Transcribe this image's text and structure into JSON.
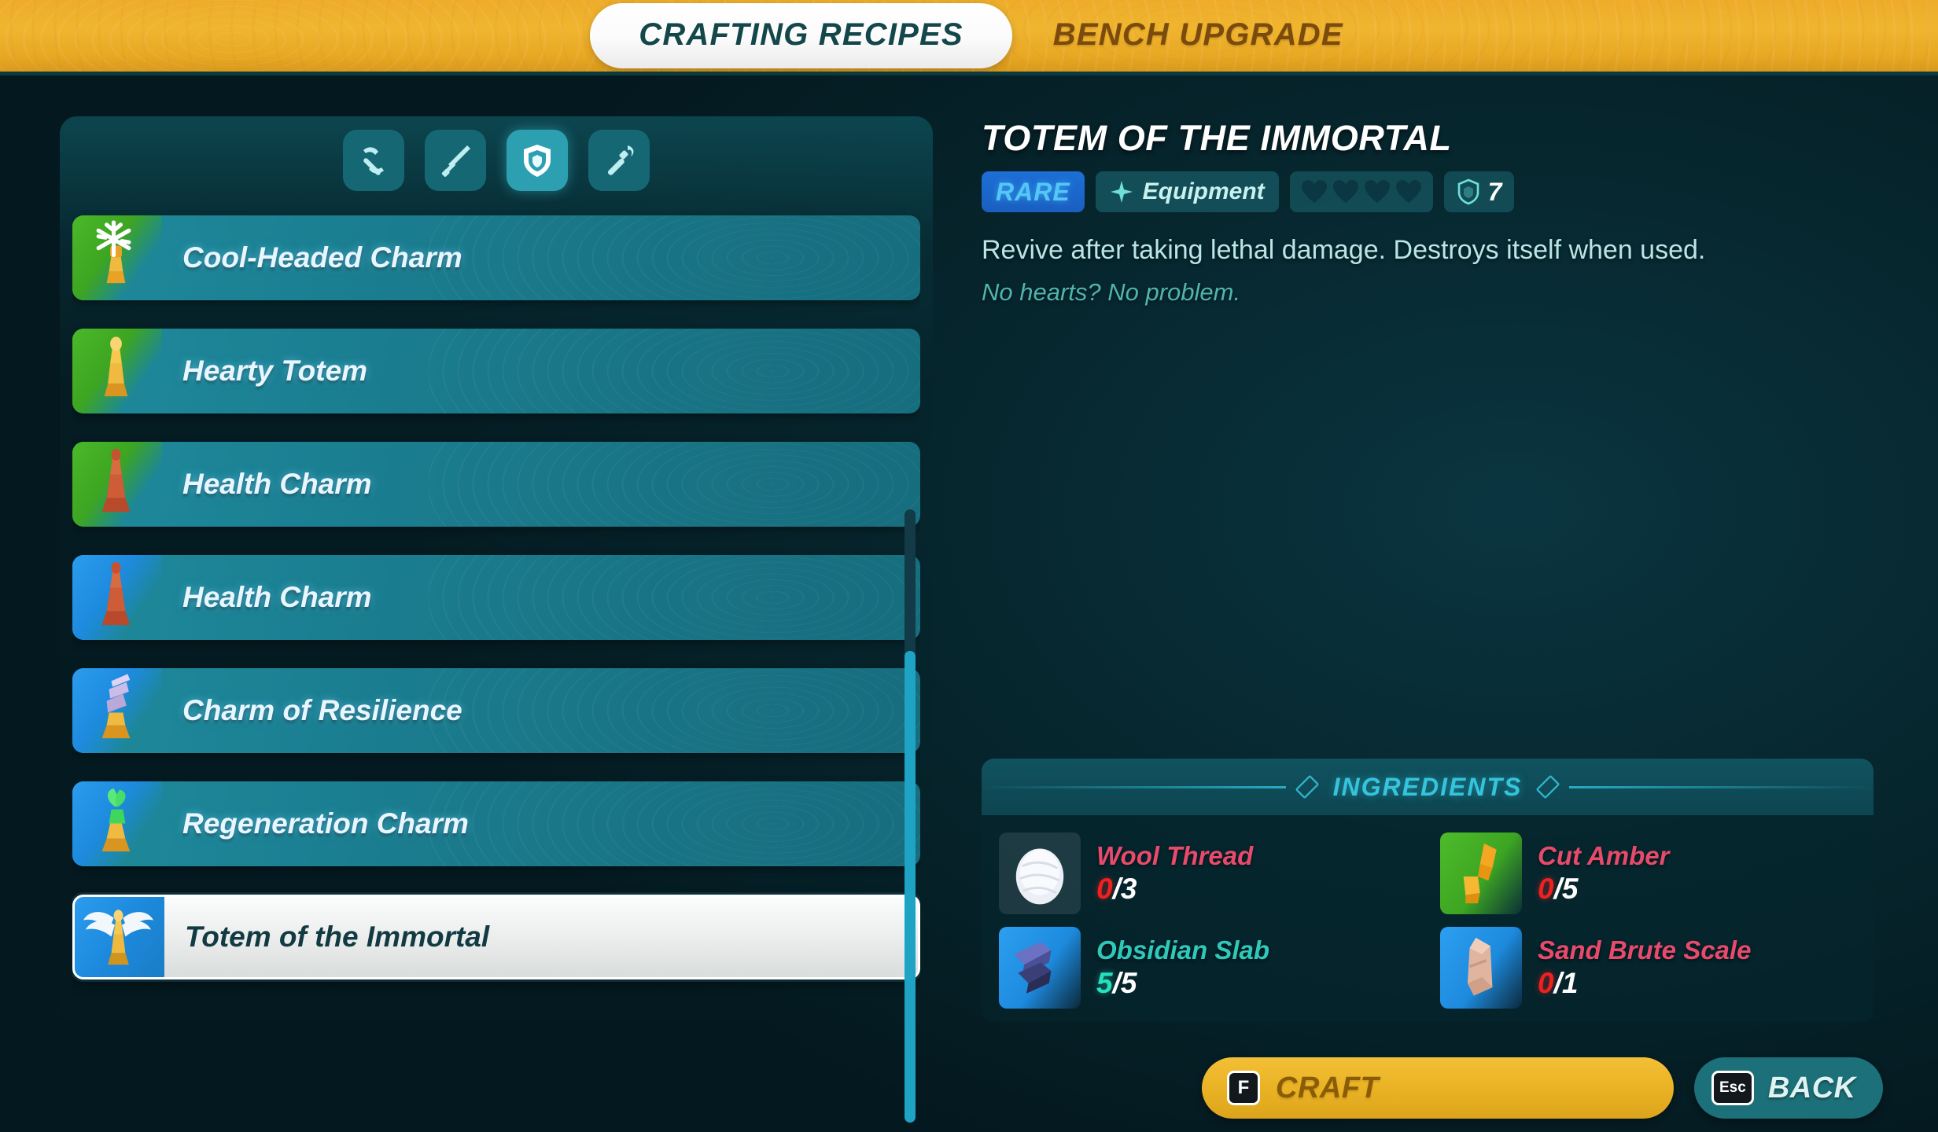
{
  "tabs": [
    {
      "label": "CRAFTING RECIPES",
      "active": true
    },
    {
      "label": "BENCH UPGRADE",
      "active": false
    }
  ],
  "filters": [
    {
      "name": "pickaxe",
      "selected": false
    },
    {
      "name": "sword",
      "selected": false
    },
    {
      "name": "shield",
      "selected": true
    },
    {
      "name": "torch",
      "selected": false
    }
  ],
  "recipes": [
    {
      "name": "",
      "rarity": "clipped",
      "icon": ""
    },
    {
      "name": "Cool-Headed Charm",
      "rarity": "green",
      "icon": "snowflake-totem"
    },
    {
      "name": "Hearty Totem",
      "rarity": "green",
      "icon": "gold-totem"
    },
    {
      "name": "Health Charm",
      "rarity": "green",
      "icon": "red-totem"
    },
    {
      "name": "Health Charm",
      "rarity": "blue",
      "icon": "red-totem"
    },
    {
      "name": "Charm of Resilience",
      "rarity": "blue",
      "icon": "purple-totem"
    },
    {
      "name": "Regeneration Charm",
      "rarity": "blue",
      "icon": "green-totem"
    },
    {
      "name": "Totem of the Immortal",
      "rarity": "blue",
      "icon": "winged-totem",
      "selected": true
    }
  ],
  "detail": {
    "title": "TOTEM OF THE IMMORTAL",
    "rarity": "RARE",
    "type": "Equipment",
    "hearts": 4,
    "defense": "7",
    "description": "Revive after taking lethal damage. Destroys itself when used.",
    "flavor": "No hearts? No problem."
  },
  "ingredients": {
    "header": "INGREDIENTS",
    "items": [
      {
        "name": "Wool Thread",
        "current": "0",
        "max": "/3",
        "status": "lack",
        "icon": "wool-ball"
      },
      {
        "name": "Cut Amber",
        "current": "0",
        "max": "/5",
        "status": "lack",
        "icon": "amber-gems"
      },
      {
        "name": "Obsidian Slab",
        "current": "5",
        "max": "/5",
        "status": "have",
        "icon": "obsidian-slab"
      },
      {
        "name": "Sand Brute Scale",
        "current": "0",
        "max": "/1",
        "status": "lack",
        "icon": "sand-scale"
      }
    ]
  },
  "footer": {
    "craft_key": "F",
    "craft_label": "CRAFT",
    "back_key": "Esc",
    "back_label": "BACK"
  },
  "colors": {
    "accent_gold": "#eab325",
    "teal": "#1c7079",
    "rare_blue": "#1d6fd6",
    "lack_red": "#f02020",
    "have_green": "#27e0c0",
    "background": "#052028"
  }
}
